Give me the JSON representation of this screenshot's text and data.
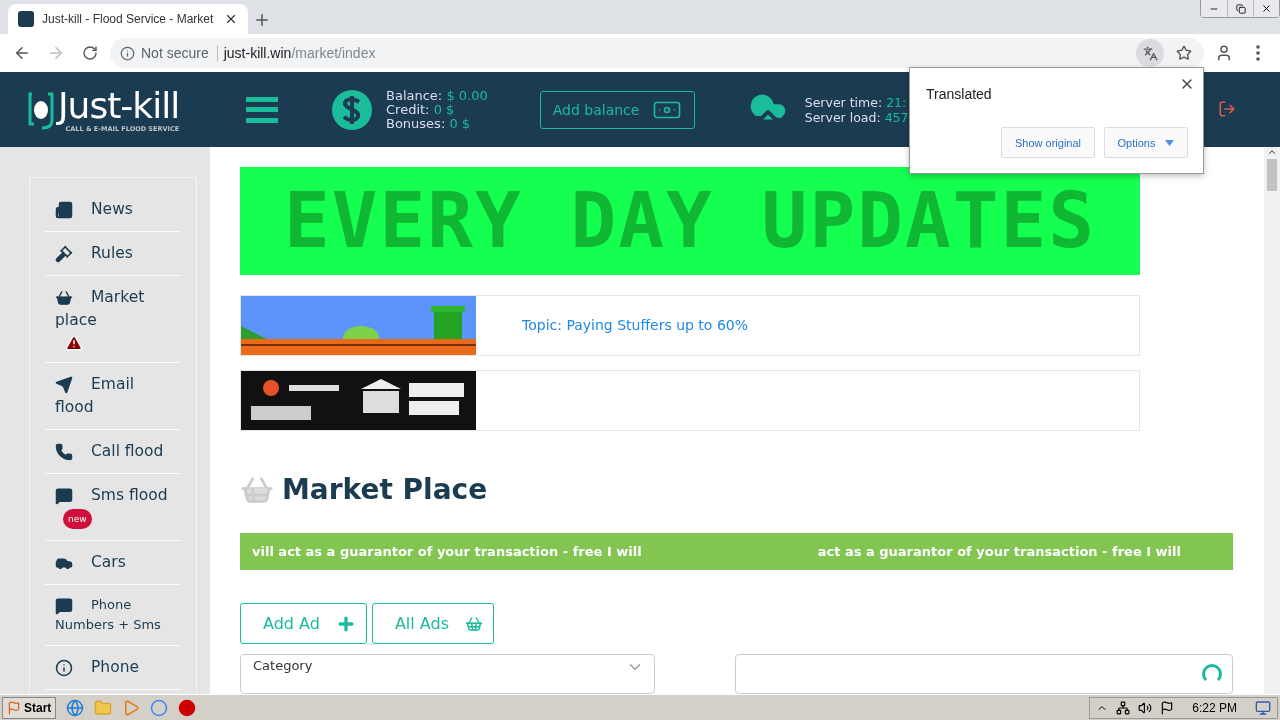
{
  "browser": {
    "tab_title": "Just-kill - Flood Service - Market",
    "security": "Not secure",
    "host": "just-kill.win",
    "path": "/market/index"
  },
  "header": {
    "logo": {
      "name": "Just-kill",
      "tagline": "CALL & E-MAIL FLOOD SERVICE"
    },
    "account": [
      {
        "label": "Balance:",
        "value": "$ 0.00"
      },
      {
        "label": "Credit:",
        "value": "0 $"
      },
      {
        "label": "Bonuses:",
        "value": "0 $"
      }
    ],
    "add_balance": "Add balance",
    "server": [
      {
        "label": "Server time:",
        "value": "21:"
      },
      {
        "label": "Server load:",
        "value": "457"
      }
    ]
  },
  "translate_popup": {
    "title": "Translated",
    "show_original": "Show original",
    "options": "Options"
  },
  "sidebar": {
    "items": [
      {
        "label": "News",
        "alert": false,
        "small": false
      },
      {
        "label": "Rules",
        "alert": false,
        "small": false
      },
      {
        "label": "Market place",
        "alert": true,
        "small": false
      },
      {
        "label": "Email flood",
        "alert": false,
        "small": false
      },
      {
        "label": "Call flood",
        "alert": false,
        "small": false
      },
      {
        "label": "Sms flood",
        "alert": false,
        "small": false,
        "badge": "new"
      },
      {
        "label": "Cars",
        "alert": false,
        "small": false
      },
      {
        "label": "Phone Numbers + Sms",
        "alert": false,
        "small": true
      },
      {
        "label": "Phone",
        "alert": false,
        "small": false
      }
    ]
  },
  "banner": {
    "text": "EVERY DAY UPDATES"
  },
  "ads": [
    {
      "kind": "picture",
      "link": "Topic: Paying Stuffers up to 60%"
    },
    {
      "kind": "picture"
    }
  ],
  "market": {
    "title": "Market Place",
    "ticker": [
      "vill act as a guarantor of your transaction - free I will",
      "act as a guarantor of your transaction - free I will"
    ],
    "buttons": [
      "Add Ad",
      "All Ads"
    ],
    "category": "Category"
  },
  "taskbar": {
    "start": "Start",
    "time": "6:22 PM"
  }
}
